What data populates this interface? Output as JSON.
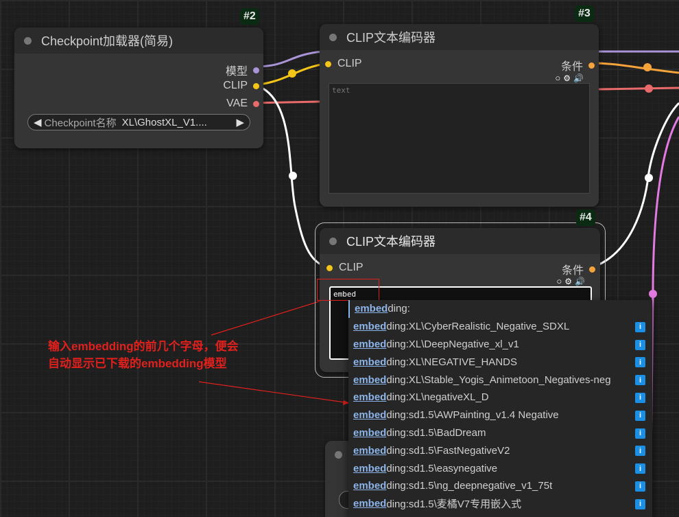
{
  "colors": {
    "model": "#a894d6",
    "clip": "#f5c518",
    "vae": "#e86a6a",
    "conditioning": "#f5a33a",
    "highlight": "#e0201c",
    "info": "#1a8fe3"
  },
  "nodes": {
    "checkpoint": {
      "badge": "#2",
      "title": "Checkpoint加载器(简易)",
      "outputs": [
        "模型",
        "CLIP",
        "VAE"
      ],
      "combo_label": "Checkpoint名称",
      "combo_value": "XL\\GhostXL_V1...."
    },
    "clip3": {
      "badge": "#3",
      "title": "CLIP文本编码器",
      "input": "CLIP",
      "output": "条件",
      "placeholder": "text"
    },
    "clip4": {
      "badge": "#4",
      "title": "CLIP文本编码器",
      "input": "CLIP",
      "output": "条件",
      "value": "embed"
    }
  },
  "autocomplete": {
    "match": "embed",
    "items": [
      {
        "rest": "ding:",
        "info": false
      },
      {
        "rest": "ding:XL\\CyberRealistic_Negative_SDXL",
        "info": true
      },
      {
        "rest": "ding:XL\\DeepNegative_xl_v1",
        "info": true
      },
      {
        "rest": "ding:XL\\NEGATIVE_HANDS",
        "info": true
      },
      {
        "rest": "ding:XL\\Stable_Yogis_Animetoon_Negatives-neg",
        "info": true
      },
      {
        "rest": "ding:XL\\negativeXL_D",
        "info": true
      },
      {
        "rest": "ding:sd1.5\\AWPainting_v1.4 Negative",
        "info": true
      },
      {
        "rest": "ding:sd1.5\\BadDream",
        "info": true
      },
      {
        "rest": "ding:sd1.5\\FastNegativeV2",
        "info": true
      },
      {
        "rest": "ding:sd1.5\\easynegative",
        "info": true
      },
      {
        "rest": "ding:sd1.5\\ng_deepnegative_v1_75t",
        "info": true
      },
      {
        "rest": "ding:sd1.5\\麦橘V7专用嵌入式",
        "info": true
      }
    ],
    "info_glyph": "i"
  },
  "annotation": {
    "line1": "输入embedding的前几个字母，便会",
    "line2": "自动显示已下载的embedding模型"
  }
}
